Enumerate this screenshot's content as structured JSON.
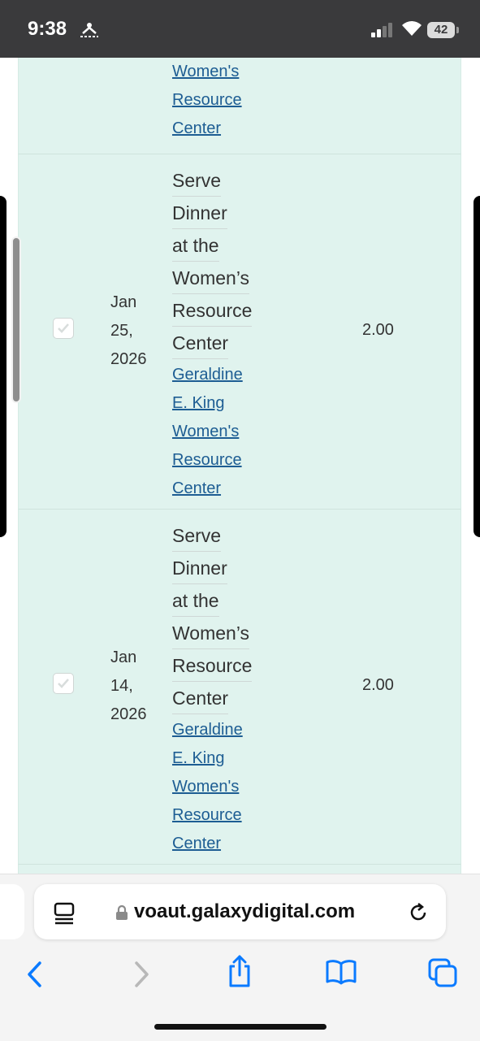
{
  "status_bar": {
    "time": "9:38",
    "battery": "42"
  },
  "table": {
    "top_row_links": [
      "Women's",
      "Resource",
      "Center"
    ],
    "rows": [
      {
        "date_lines": [
          "Jan",
          "25,",
          "2026"
        ],
        "desc_lines": [
          "Serve",
          "Dinner",
          "at the",
          "Women’s",
          "Resource",
          "Center"
        ],
        "link_lines": [
          "Geraldine",
          "E. King",
          "Women's",
          "Resource",
          "Center"
        ],
        "hours": "2.00"
      },
      {
        "date_lines": [
          "Jan",
          "14,",
          "2026"
        ],
        "desc_lines": [
          "Serve",
          "Dinner",
          "at the",
          "Women’s",
          "Resource",
          "Center"
        ],
        "link_lines": [
          "Geraldine",
          "E. King",
          "Women's",
          "Resource",
          "Center"
        ],
        "hours": "2.00"
      }
    ]
  },
  "browser": {
    "url": "voaut.galaxydigital.com"
  },
  "colors": {
    "row_background": "#e0f3ee",
    "link": "#1d5d93",
    "ios_blue": "#0a7aff"
  }
}
